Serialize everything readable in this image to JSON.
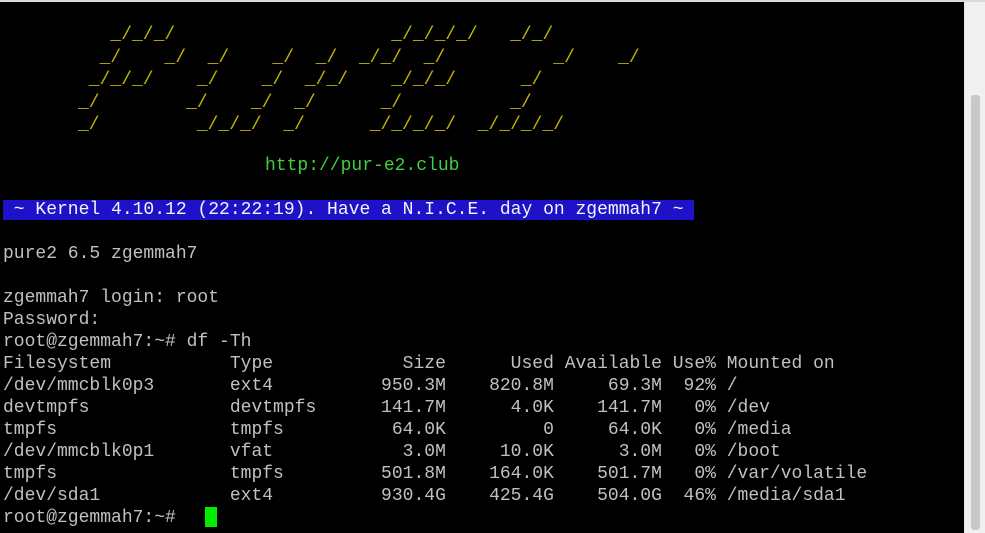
{
  "colors": {
    "background": "#000000",
    "text": "#c0c0c0",
    "banner": "#c6b400",
    "url": "#3fcf3f",
    "motd_bg": "#1e12c8",
    "cursor": "#00ee00"
  },
  "banner": {
    "ascii_art": "   _/_/_/                    _/_/_/_/   _/_/\n  _/    _/  _/    _/  _/  _/_/  _/          _/    _/\n _/_/_/    _/    _/  _/_/    _/_/_/      _/\n_/        _/    _/  _/      _/          _/\n_/         _/_/_/  _/      _/_/_/_/  _/_/_/_/",
    "url": "http://pur-e2.club"
  },
  "motd": " ~ Kernel 4.10.12 (22:22:19). Have a N.I.C.E. day on zgemmah7 ~ ",
  "system_info": "pure2 6.5 zgemmah7",
  "login": {
    "login_line": "zgemmah7 login: root",
    "password_line": "Password:"
  },
  "command": {
    "prompt": "root@zgemmah7:~#",
    "text": "df -Th"
  },
  "df_table": {
    "header": "Filesystem           Type            Size      Used Available Use% Mounted on",
    "rows": [
      "/dev/mmcblk0p3       ext4          950.3M    820.8M     69.3M  92% /",
      "devtmpfs             devtmpfs      141.7M      4.0K    141.7M   0% /dev",
      "tmpfs                tmpfs          64.0K         0     64.0K   0% /media",
      "/dev/mmcblk0p1       vfat            3.0M     10.0K      3.0M   0% /boot",
      "tmpfs                tmpfs         501.8M    164.0K    501.7M   0% /var/volatile",
      "/dev/sda1            ext4          930.4G    425.4G    504.0G  46% /media/sda1"
    ]
  },
  "final_prompt": "root@zgemmah7:~#",
  "scrollbar": {
    "position_fraction": 1.0
  }
}
